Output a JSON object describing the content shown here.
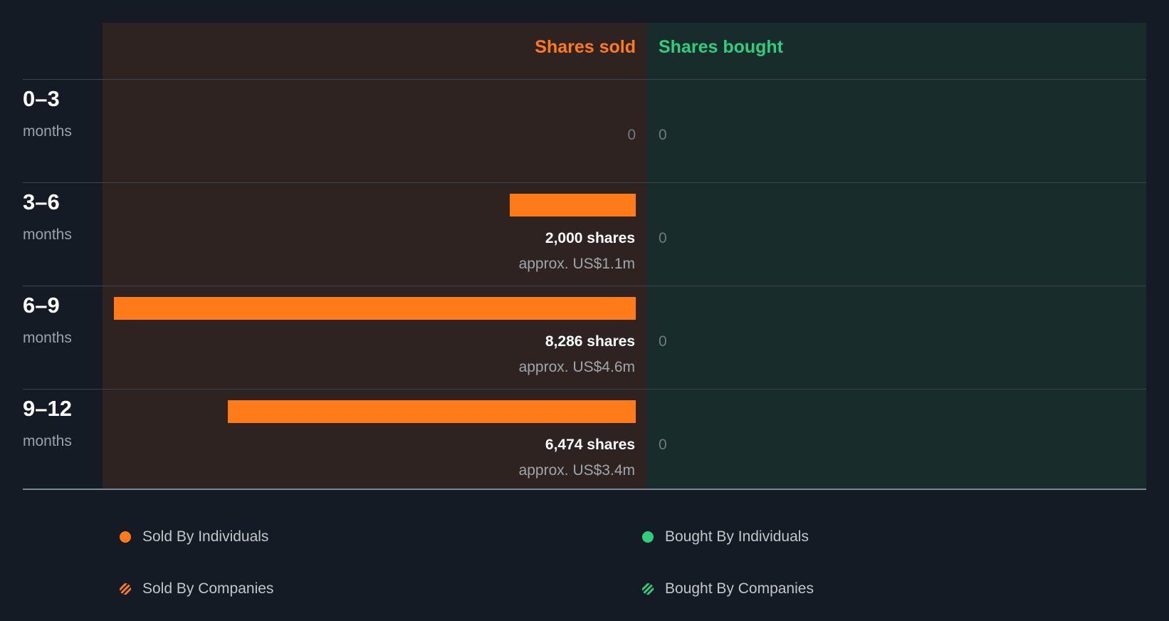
{
  "chart_data": {
    "type": "bar",
    "orientation": "horizontal-diverging",
    "columns": {
      "sold_label": "Shares sold",
      "bought_label": "Shares bought"
    },
    "categories": [
      {
        "num": "0–3",
        "unit": "months"
      },
      {
        "num": "3–6",
        "unit": "months"
      },
      {
        "num": "6–9",
        "unit": "months"
      },
      {
        "num": "9–12",
        "unit": "months"
      }
    ],
    "sold": [
      {
        "value": 0,
        "zero_label": "0",
        "shares_label": "",
        "approx_label": ""
      },
      {
        "value": 2000,
        "zero_label": "",
        "shares_label": "2,000 shares",
        "approx_label": "approx. US$1.1m"
      },
      {
        "value": 8286,
        "zero_label": "",
        "shares_label": "8,286 shares",
        "approx_label": "approx. US$4.6m"
      },
      {
        "value": 6474,
        "zero_label": "",
        "shares_label": "6,474 shares",
        "approx_label": "approx. US$3.4m"
      }
    ],
    "bought": [
      {
        "value": 0,
        "label": "0"
      },
      {
        "value": 0,
        "label": "0"
      },
      {
        "value": 0,
        "label": "0"
      },
      {
        "value": 0,
        "label": "0"
      }
    ],
    "max_value": 8286,
    "legend": [
      {
        "label": "Sold By Individuals",
        "color": "#ff7a18",
        "style": "solid"
      },
      {
        "label": "Bought By Individuals",
        "color": "#2fce7d",
        "style": "solid"
      },
      {
        "label": "Sold By Companies",
        "color": "#ff7a18",
        "style": "striped"
      },
      {
        "label": "Bought By Companies",
        "color": "#2fce7d",
        "style": "striped"
      }
    ],
    "colors": {
      "sold": "#ff7a18",
      "bought": "#2fce7d"
    }
  }
}
